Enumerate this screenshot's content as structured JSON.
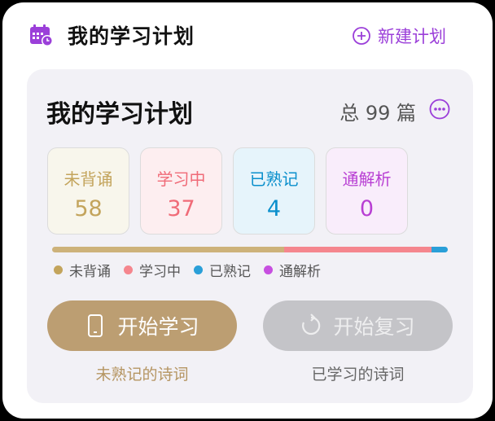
{
  "header": {
    "title": "我的学习计划",
    "new_plan_label": "新建计划"
  },
  "card": {
    "title": "我的学习计划",
    "total": "总 99 篇",
    "stats": [
      {
        "label": "未背诵",
        "value": "58"
      },
      {
        "label": "学习中",
        "value": "37"
      },
      {
        "label": "已熟记",
        "value": "4"
      },
      {
        "label": "通解析",
        "value": "0"
      }
    ],
    "legend": [
      {
        "label": "未背诵",
        "color": "#c3a45c"
      },
      {
        "label": "学习中",
        "color": "#f5868e"
      },
      {
        "label": "已熟记",
        "color": "#2a9fd8"
      },
      {
        "label": "通解析",
        "color": "#c74fe0"
      }
    ],
    "progress": {
      "not_recited": 58,
      "learning": 37,
      "mastered": 4,
      "analyzed": 0,
      "total": 99
    },
    "start_button": "开始学习",
    "review_button": "开始复习",
    "start_sub": "未熟记的诗词",
    "review_sub": "已学习的诗词"
  },
  "colors": {
    "accent": "#9b3fd9",
    "start_button": "#bc9e72",
    "review_button": "#c4c4c8"
  },
  "icons": {
    "header": "calendar-icon",
    "new_plan": "add-circle-icon",
    "more": "more-icon",
    "start": "phone-icon",
    "review": "refresh-icon"
  }
}
